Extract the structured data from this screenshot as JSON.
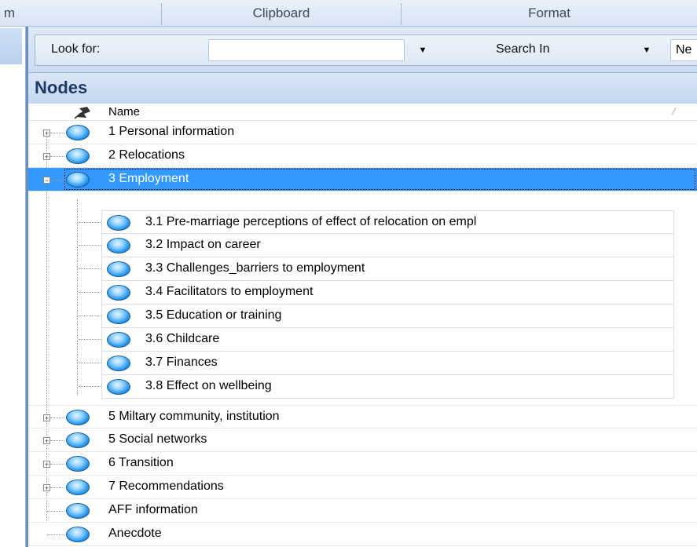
{
  "ribbon": {
    "partial_group": "m",
    "clipboard": "Clipboard",
    "format": "Format"
  },
  "find_bar": {
    "look_for_label": "Look for:",
    "look_for_value": "",
    "search_in_label": "Search In",
    "search_in_value": "Ne"
  },
  "panel": {
    "title": "Nodes",
    "column_name": "Name"
  },
  "nodes": [
    {
      "label": "1 Personal information",
      "expandable": true
    },
    {
      "label": "2 Relocations",
      "expandable": true
    },
    {
      "label": "3 Employment",
      "expanded": true,
      "selected": true
    },
    {
      "label": "5 Miltary community, institution",
      "expandable": true
    },
    {
      "label": "5 Social networks",
      "expandable": true
    },
    {
      "label": "6 Transition",
      "expandable": true
    },
    {
      "label": "7 Recommendations",
      "expandable": true
    },
    {
      "label": "AFF information",
      "expandable": false
    },
    {
      "label": "Anecdote",
      "expandable": false
    }
  ],
  "children": [
    {
      "label": "3.1 Pre-marriage perceptions of effect of relocation on empl"
    },
    {
      "label": "3.2 Impact on career"
    },
    {
      "label": "3.3 Challenges_barriers to employment"
    },
    {
      "label": "3.4 Facilitators to employment"
    },
    {
      "label": "3.5 Education or training"
    },
    {
      "label": "3.6 Childcare"
    },
    {
      "label": "3.7 Finances"
    },
    {
      "label": "3.8 Effect on wellbeing"
    }
  ],
  "colors": {
    "selection": "#3399ff",
    "panel_header": "#c4d7ef",
    "title_text": "#1c3a66"
  },
  "icons": [
    "pin-icon",
    "node-icon",
    "expand-plus-icon",
    "collapse-minus-icon",
    "dropdown-arrow-icon",
    "sort-icon"
  ]
}
